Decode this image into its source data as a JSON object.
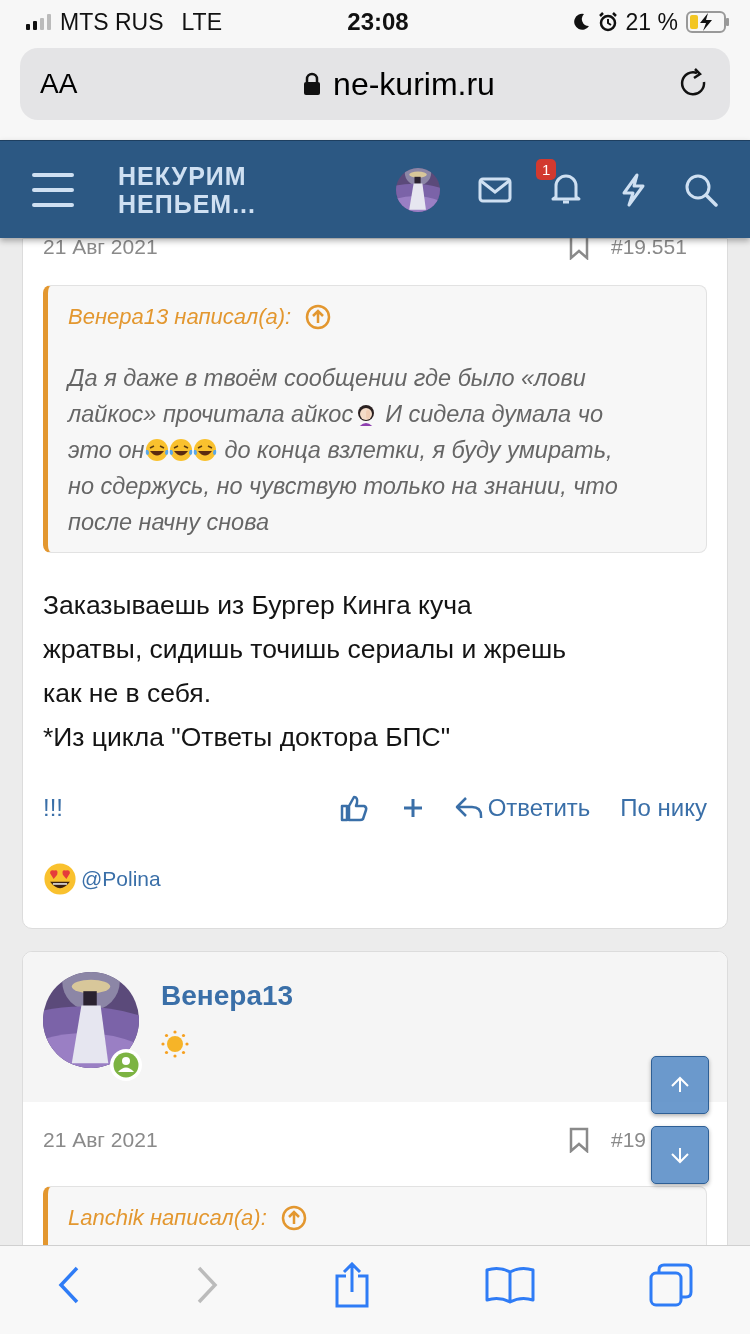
{
  "status_bar": {
    "carrier": "MTS RUS",
    "network": "LTE",
    "time": "23:08",
    "battery": "21 %"
  },
  "browser_bar": {
    "text_size": "AA",
    "url": "ne-kurim.ru"
  },
  "site_header": {
    "logo": [
      "НЕКУРИМ",
      "НЕПЬЕМ..."
    ],
    "notifications_badge": "1"
  },
  "posts": [
    {
      "date": "21 Авг 2021",
      "number": "#19.551",
      "quote": {
        "author": "Венера13 написал(а):",
        "lines": [
          [
            {
              "kind": "text",
              "text": "Да я даже в твоём сообщении где было «лови"
            }
          ],
          [
            {
              "kind": "text",
              "text": "лайкос» прочитала айкос"
            },
            {
              "kind": "facepalm"
            },
            {
              "kind": "text",
              "text": "И сидела думала чо"
            }
          ],
          [
            {
              "kind": "text",
              "text": "это он"
            },
            {
              "kind": "laugh"
            },
            {
              "kind": "laugh"
            },
            {
              "kind": "laugh"
            },
            {
              "kind": "text",
              "text": "до конца взлетки, я буду умирать,"
            }
          ],
          [
            {
              "kind": "text",
              "text": "но сдержусь, но чувствую только на знании, что"
            }
          ],
          [
            {
              "kind": "text",
              "text": "после начну снова"
            }
          ]
        ]
      },
      "body": [
        "Заказываешь из Бургер Кинга куча",
        "жратвы, сидишь точишь сериалы и жрешь",
        "как не в себя.",
        "*Из цикла \"Ответы доктора БПС\""
      ],
      "actions": {
        "report": "!!!",
        "reply": "Ответить",
        "by_nick": "По нику"
      },
      "reactions": {
        "users": "@Polina"
      }
    },
    {
      "author": "Венера13",
      "online": true,
      "date": "21 Авг 2021",
      "number": "#19",
      "quote": {
        "author": "Lanchik написал(а):"
      }
    }
  ]
}
